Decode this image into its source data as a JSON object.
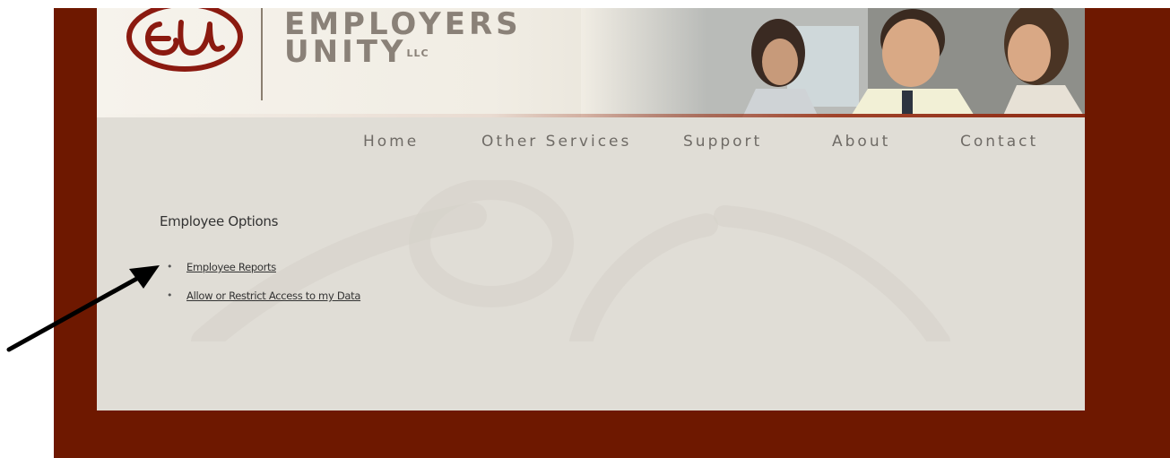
{
  "brand": {
    "name_line1": "EMPLOYERS",
    "name_line2": "UNITY",
    "name_suffix": "LLC",
    "logo_monogram": "EU"
  },
  "nav": {
    "items": [
      {
        "label": "Home"
      },
      {
        "label": "Other Services"
      },
      {
        "label": "Support"
      },
      {
        "label": "About"
      },
      {
        "label": "Contact"
      }
    ]
  },
  "main": {
    "section_title": "Employee Options",
    "links": [
      {
        "label": "Employee Reports"
      },
      {
        "label": "Allow or Restrict Access to my Data"
      }
    ]
  },
  "colors": {
    "maroon": "#6e1800",
    "content_bg": "#e0ddd6",
    "logo_red": "#8b1a10",
    "brand_text": "#8a8178"
  },
  "icons": {
    "logo": "eu-monogram-logo",
    "annotation": "arrow-pointer-icon"
  }
}
